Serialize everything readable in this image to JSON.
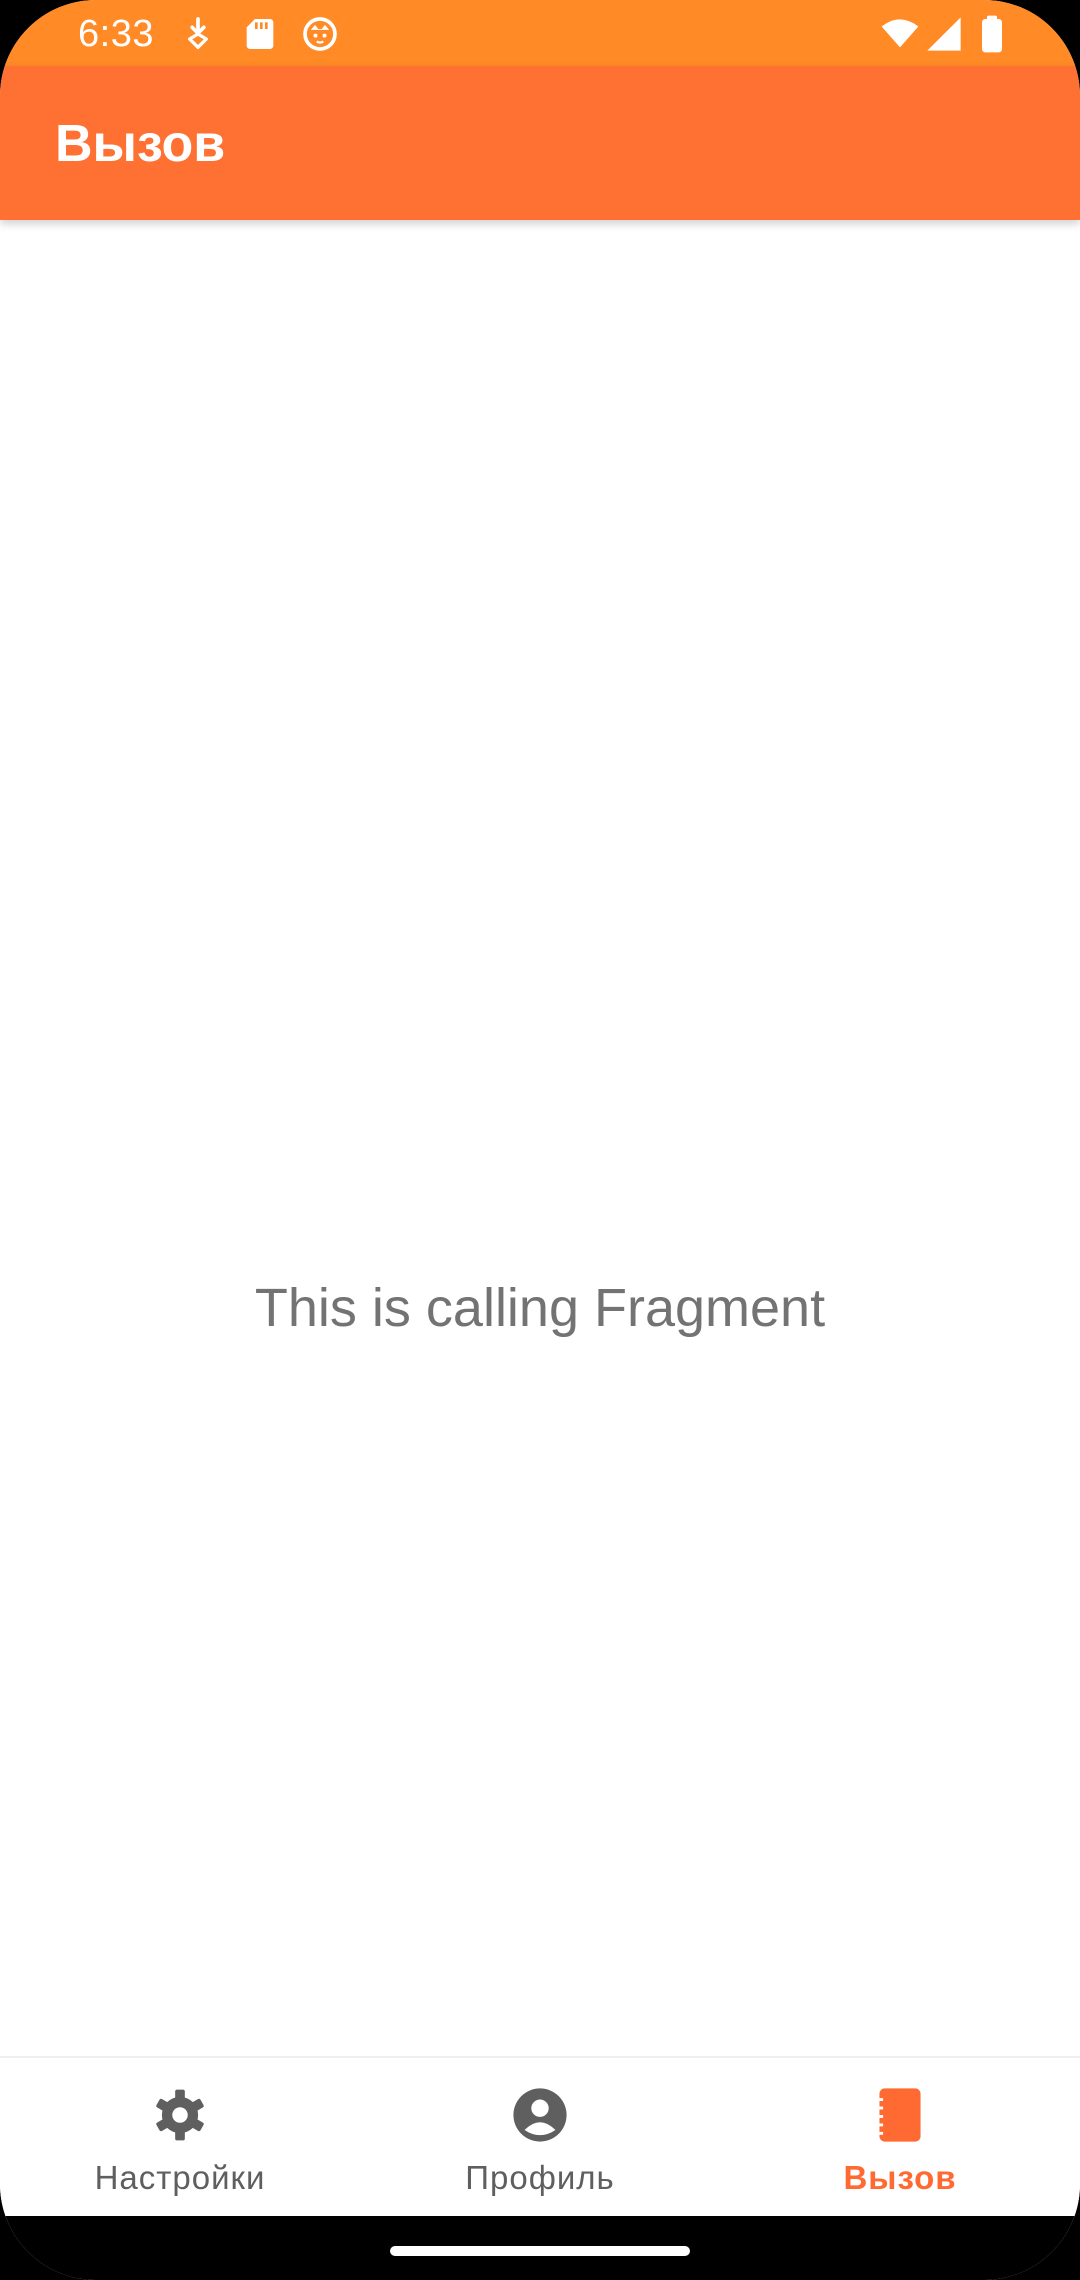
{
  "status_bar": {
    "time": "6:33",
    "left_icons": [
      "download-icon",
      "sd-card-icon",
      "cat-face-icon"
    ],
    "right_icons": [
      "wifi-icon",
      "cellular-signal-icon",
      "battery-icon"
    ],
    "color": "#FF8A26"
  },
  "app_bar": {
    "title": "Вызов",
    "color": "#FF7033"
  },
  "content": {
    "message": "This is calling Fragment"
  },
  "bottom_nav": {
    "active_color": "#FF6A33",
    "inactive_color": "#5F5F5F",
    "items": [
      {
        "label": "Настройки",
        "icon": "gear-icon",
        "active": false
      },
      {
        "label": "Профиль",
        "icon": "account-circle-icon",
        "active": false
      },
      {
        "label": "Вызов",
        "icon": "contacts-book-icon",
        "active": true
      }
    ]
  }
}
